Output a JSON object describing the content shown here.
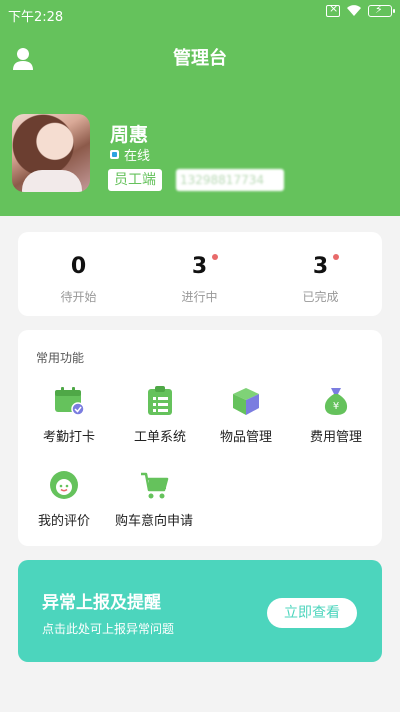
{
  "status_bar": {
    "time": "下午2:28",
    "battery": "⚡"
  },
  "header": {
    "title": "管理台"
  },
  "profile": {
    "name": "周惠",
    "status": "在线",
    "role": "员工端",
    "phone": "13298817734"
  },
  "stats": [
    {
      "value": "0",
      "label": "待开始",
      "has_dot": false
    },
    {
      "value": "3",
      "label": "进行中",
      "has_dot": true
    },
    {
      "value": "3",
      "label": "已完成",
      "has_dot": true
    }
  ],
  "functions": {
    "title": "常用功能",
    "items": [
      {
        "label": "考勤打卡",
        "icon": "calendar-check-icon"
      },
      {
        "label": "工单系统",
        "icon": "clipboard-list-icon"
      },
      {
        "label": "物品管理",
        "icon": "box-icon"
      },
      {
        "label": "费用管理",
        "icon": "money-bag-icon"
      },
      {
        "label": "我的评价",
        "icon": "smile-face-icon"
      },
      {
        "label": "购车意向申请",
        "icon": "shopping-cart-icon"
      }
    ]
  },
  "alert": {
    "title": "异常上报及提醒",
    "subtitle": "点击此处可上报异常问题",
    "button": "立即查看"
  },
  "colors": {
    "primary_green": "#65c25c",
    "teal": "#4cd5bd",
    "badge_red": "#e86a6a",
    "icon_purple": "#7b7de0"
  }
}
